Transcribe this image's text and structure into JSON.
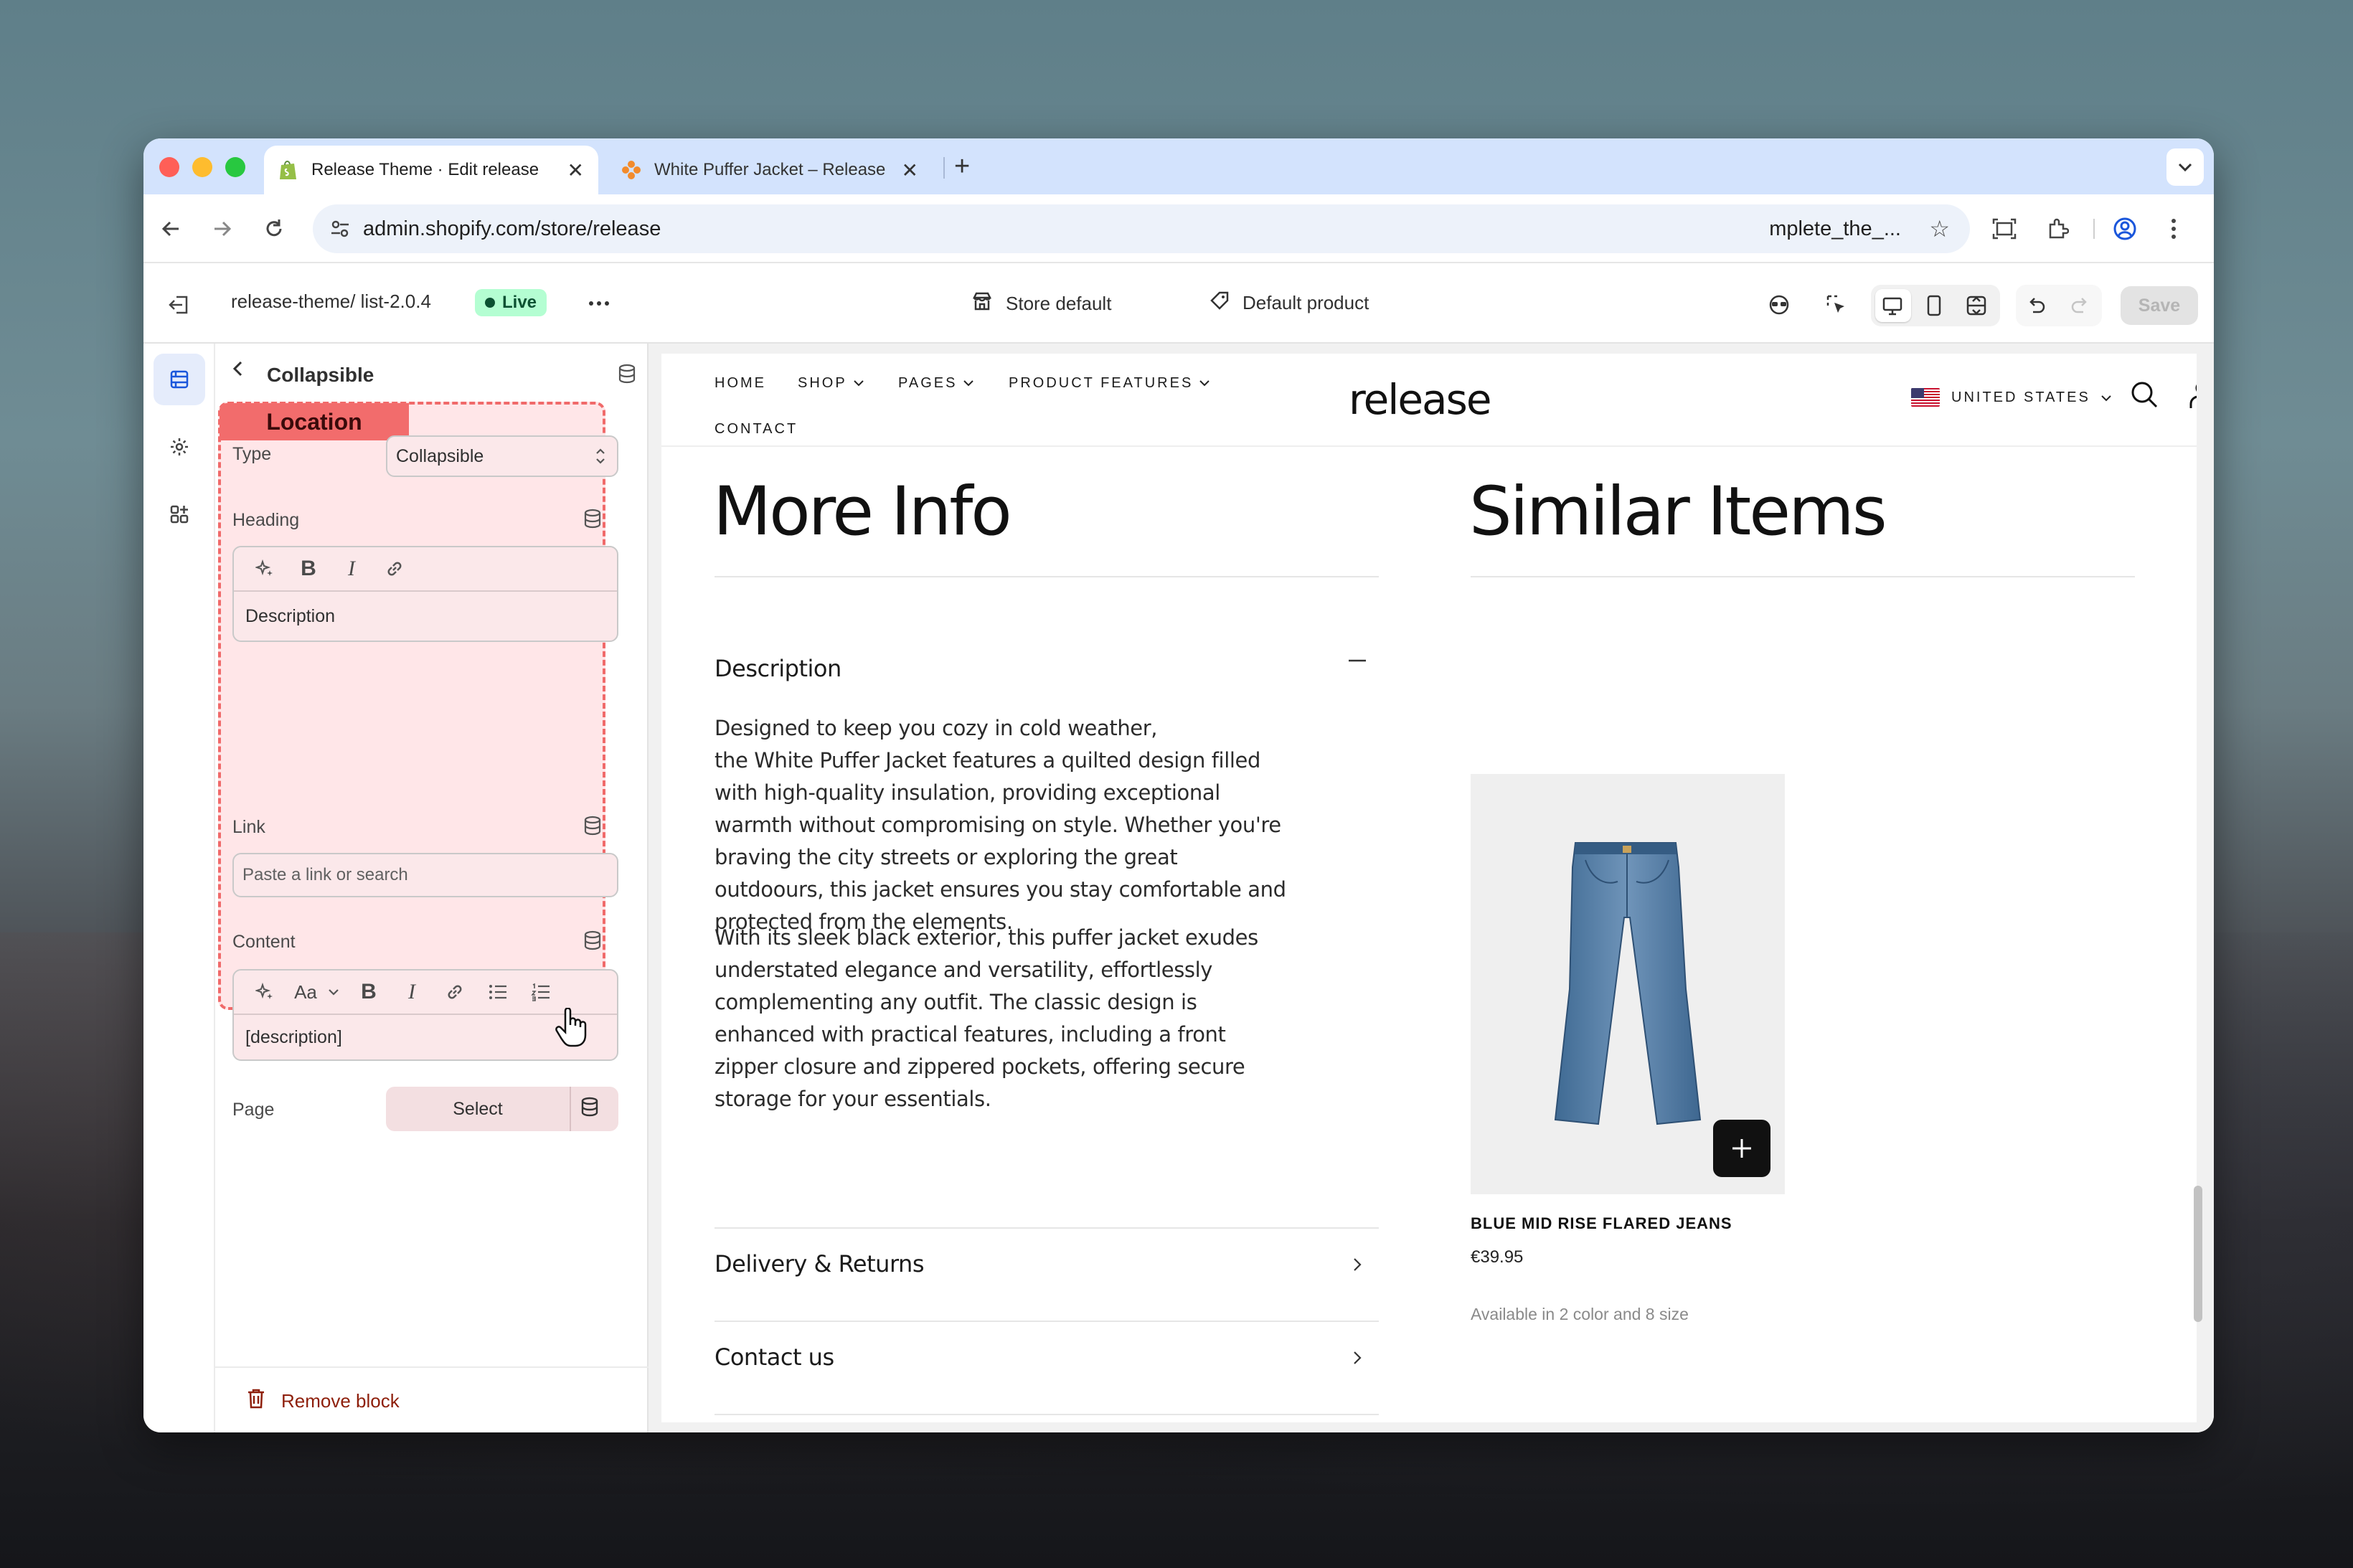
{
  "browser": {
    "tabs": [
      {
        "title": "Release Theme · Edit release",
        "favicon": "shopify-bag-icon",
        "active": true
      },
      {
        "title": "White Puffer Jacket – Release",
        "favicon": "release-logo-icon",
        "active": false
      }
    ],
    "url": "admin.shopify.com/store/release",
    "url_tail": "mplete_the_..."
  },
  "editor": {
    "theme_name": "release-theme/ list-2.0.4",
    "live_label": "Live",
    "store_default": "Store default",
    "default_product": "Default product",
    "save_label": "Save"
  },
  "panel": {
    "title": "Collapsible",
    "location_tag": "Location",
    "type_label": "Type",
    "type_value": "Collapsible",
    "heading_label": "Heading",
    "heading_value": "Description",
    "link_label": "Link",
    "link_placeholder": "Paste a link or search",
    "content_label": "Content",
    "content_font_label": "Aa",
    "content_value": "[description]",
    "page_label": "Page",
    "page_select": "Select",
    "remove_block": "Remove block"
  },
  "store": {
    "nav": [
      {
        "label": "HOME",
        "dropdown": false
      },
      {
        "label": "SHOP",
        "dropdown": true
      },
      {
        "label": "PAGES",
        "dropdown": true
      },
      {
        "label": "PRODUCT FEATURES",
        "dropdown": true
      },
      {
        "label": "CONTACT",
        "dropdown": false
      }
    ],
    "logo": "release",
    "country": "UNITED STATES",
    "more_info_title": "More Info",
    "similar_items_title": "Similar Items",
    "accordion": [
      {
        "title": "Description",
        "expanded": true
      },
      {
        "title": "Delivery & Returns",
        "expanded": false
      },
      {
        "title": "Contact us",
        "expanded": false
      }
    ],
    "description_p1": "Designed to keep you cozy in cold weather,\nthe White Puffer Jacket features a quilted design filled with high-quality insulation, providing exceptional warmth without compromising on style. Whether you're braving the city streets or exploring the great outdoours, this jacket ensures you stay comfortable and protected from the elements.",
    "description_p2": "With its sleek black exterior, this puffer jacket exudes understated elegance and versatility, effortlessly complementing any outfit. The classic design is enhanced with practical features, including a front zipper closure and zippered pockets, offering secure storage for your essentials.",
    "product": {
      "name": "BLUE MID RISE FLARED JEANS",
      "price": "€39.95",
      "availability": "Available in 2 color and 8 size"
    }
  },
  "colors": {
    "live_badge_bg": "#b4fed2",
    "highlight_border": "#f06a6a",
    "remove_text": "#8e1f0b"
  }
}
